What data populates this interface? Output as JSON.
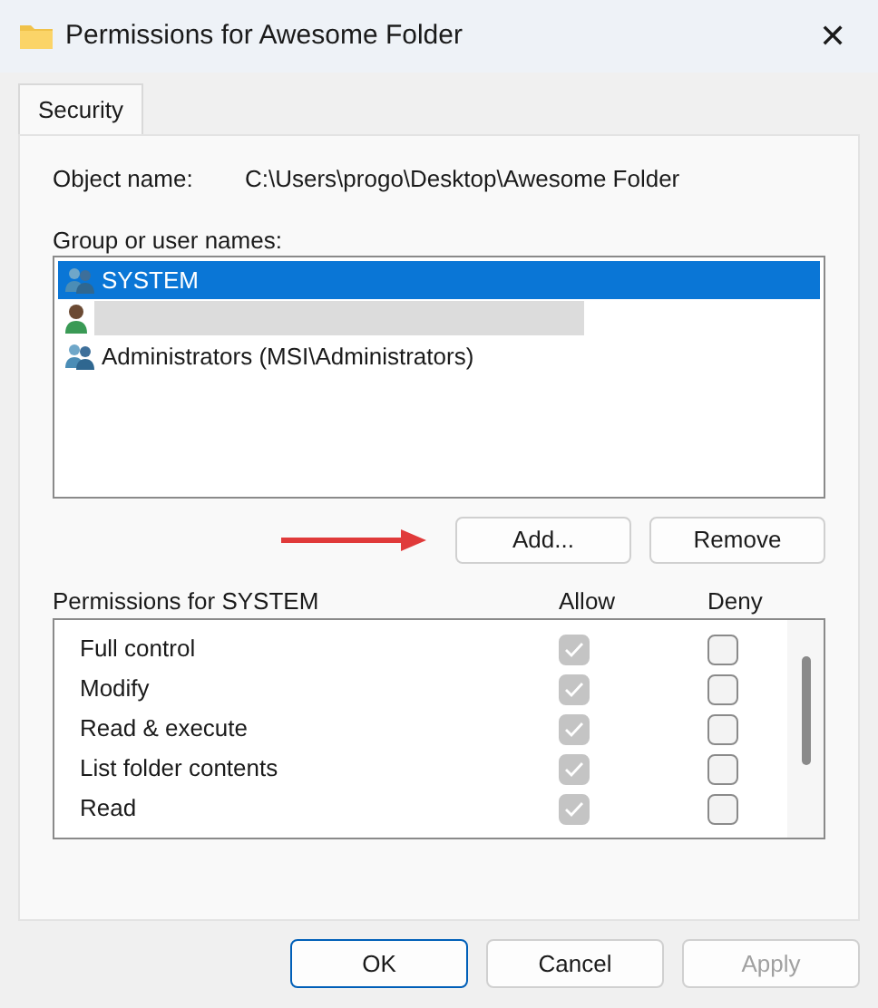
{
  "window": {
    "title": "Permissions for Awesome Folder",
    "close": "✕"
  },
  "tabs": [
    {
      "label": "Security",
      "selected": true
    }
  ],
  "object_name": {
    "label": "Object name:",
    "value": "C:\\Users\\progo\\Desktop\\Awesome Folder"
  },
  "users": {
    "label": "Group or user names:",
    "items": [
      {
        "kind": "group",
        "name": "SYSTEM",
        "selected": true
      },
      {
        "kind": "user",
        "redacted": true,
        "selected": false
      },
      {
        "kind": "group",
        "name": "Administrators (MSI\\Administrators)",
        "selected": false
      }
    ]
  },
  "user_buttons": [
    {
      "label": "Add...",
      "disabled": false
    },
    {
      "label": "Remove",
      "disabled": false
    }
  ],
  "permissions": {
    "label": "Permissions for SYSTEM",
    "allow_label": "Allow",
    "deny_label": "Deny",
    "rows": [
      {
        "label": "Full control",
        "allow": true,
        "deny": false
      },
      {
        "label": "Modify",
        "allow": true,
        "deny": false
      },
      {
        "label": "Read & execute",
        "allow": true,
        "deny": false
      },
      {
        "label": "List folder contents",
        "allow": true,
        "deny": false
      },
      {
        "label": "Read",
        "allow": true,
        "deny": false
      }
    ]
  },
  "buttons": [
    {
      "label": "OK",
      "default": true,
      "disabled": false
    },
    {
      "label": "Cancel",
      "default": false,
      "disabled": false
    },
    {
      "label": "Apply",
      "default": false,
      "disabled": true
    }
  ]
}
